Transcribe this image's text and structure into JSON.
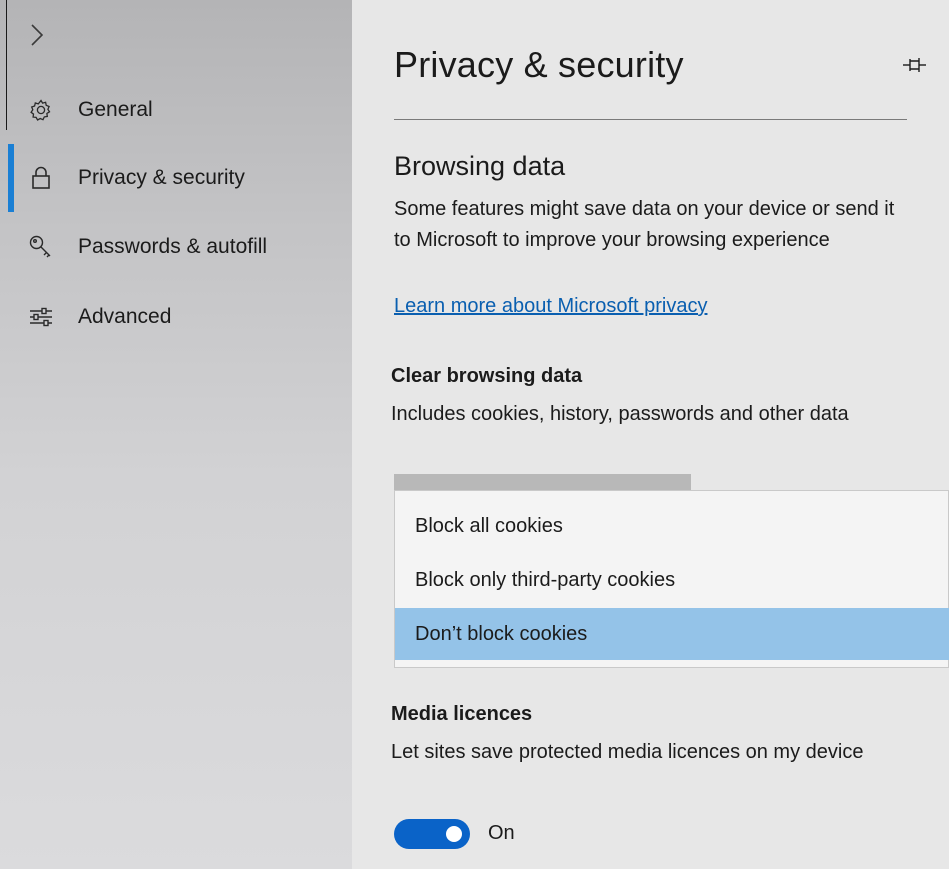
{
  "sidebar": {
    "expand_glyph": ">",
    "items": [
      {
        "label": "General",
        "icon": "gear-icon"
      },
      {
        "label": "Privacy & security",
        "icon": "lock-icon",
        "selected": true
      },
      {
        "label": "Passwords & autofill",
        "icon": "key-icon"
      },
      {
        "label": "Advanced",
        "icon": "sliders-icon"
      }
    ]
  },
  "main": {
    "title": "Privacy & security",
    "pin_icon": "pin-icon",
    "browsing": {
      "title": "Browsing data",
      "description": "Some features might save data on your device or send it to Microsoft to improve your browsing experience",
      "link": "Learn more about Microsoft privacy"
    },
    "clear": {
      "title": "Clear browsing data",
      "description": "Includes cookies, history, passwords and other data"
    },
    "cookies_dropdown": {
      "options": [
        "Block all cookies",
        "Block only third-party cookies",
        "Don’t block cookies"
      ],
      "selected": "Don’t block cookies"
    },
    "media": {
      "title": "Media licences",
      "description": "Let sites save protected media licences on my device",
      "toggle_state": "On"
    }
  },
  "colors": {
    "accent": "#1a7fd4",
    "toggle_on": "#0a63c8",
    "selected_option": "#94c3e8",
    "link": "#0a5fb0"
  }
}
